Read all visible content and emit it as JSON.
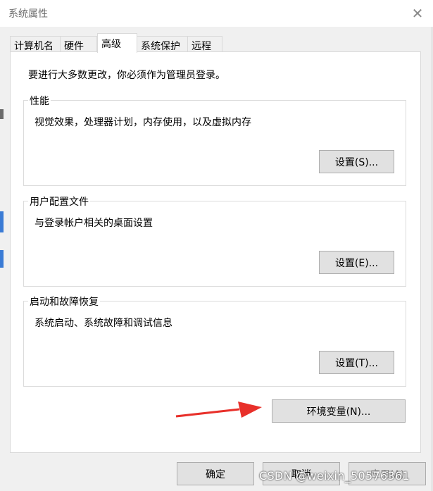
{
  "window": {
    "title": "系统属性",
    "close_glyph": "✕"
  },
  "tabs": [
    "计算机名",
    "硬件",
    "高级",
    "系统保护",
    "远程"
  ],
  "active_tab_index": 2,
  "advanced": {
    "admin_note": "要进行大多数更改，你必须作为管理员登录。",
    "performance": {
      "title": "性能",
      "description": "视觉效果，处理器计划，内存使用，以及虚拟内存",
      "button": "设置(S)..."
    },
    "user_profiles": {
      "title": "用户配置文件",
      "description": "与登录帐户相关的桌面设置",
      "button": "设置(E)..."
    },
    "startup_recovery": {
      "title": "启动和故障恢复",
      "description": "系统启动、系统故障和调试信息",
      "button": "设置(T)..."
    },
    "env_button": "环境变量(N)..."
  },
  "footer": {
    "ok": "确定",
    "cancel": "取消",
    "apply": "应用(A)"
  },
  "watermark": "CSDN @weixin_50576361",
  "colors": {
    "arrow": "#e8302a",
    "button_bg": "#e1e1e1",
    "panel_bg": "#ffffff",
    "window_bg": "#f0f0f0"
  }
}
